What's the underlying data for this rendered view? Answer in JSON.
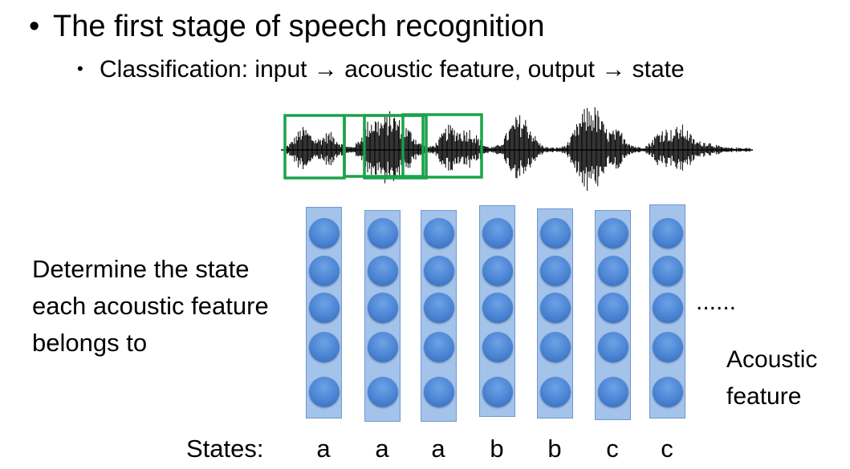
{
  "slide": {
    "bullet1": "The first stage of speech recognition",
    "bullet2": "Classification: input → acoustic feature, output → state",
    "description_lines": [
      "Determine the state",
      "each acoustic feature",
      "belongs to"
    ],
    "ellipsis": "......",
    "acoustic_label_lines": [
      "Acoustic",
      "feature"
    ],
    "states_label": "States:",
    "states": [
      "a",
      "a",
      "a",
      "b",
      "b",
      "c",
      "c"
    ]
  },
  "colors": {
    "frame_box": "#1aa34a",
    "column_fill": "#a4c3ea",
    "neuron": "#4a84d3"
  }
}
